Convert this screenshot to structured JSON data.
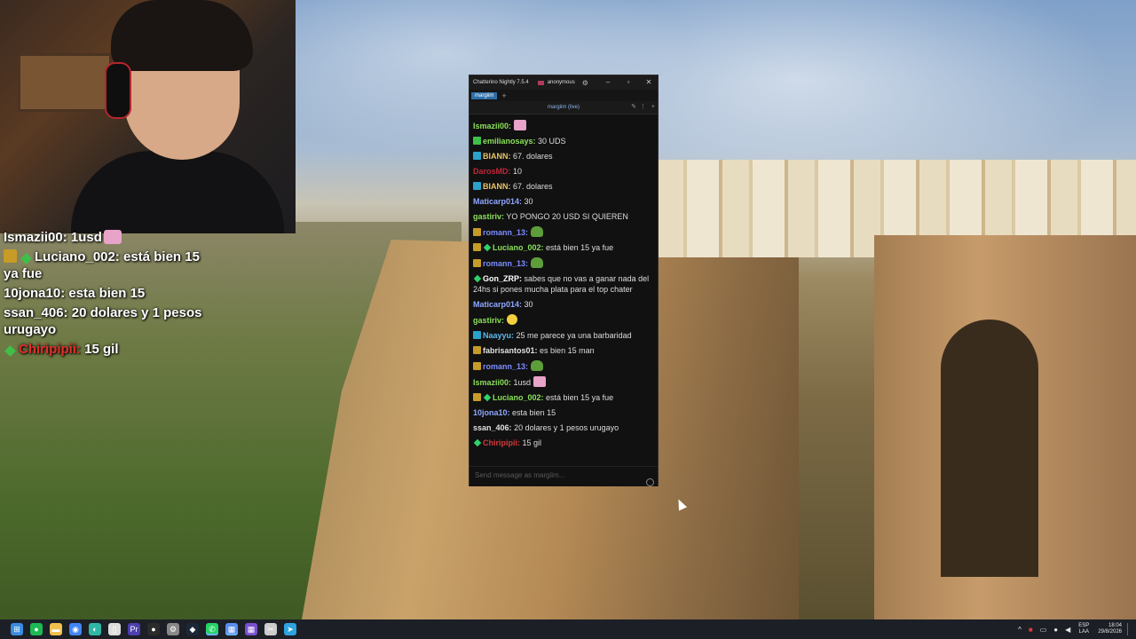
{
  "overlay": {
    "lines": [
      {
        "user": "Ismazii00:",
        "text": "1usd",
        "color": "#ffffff",
        "badges": [],
        "emote": "pink"
      },
      {
        "user": "Luciano_002:",
        "text": "está bien 15 ya fue",
        "color": "#ffffff",
        "badges": [
          "sub",
          "green"
        ]
      },
      {
        "user": "10jona10:",
        "text": "esta bien 15",
        "color": "#ffffff",
        "badges": []
      },
      {
        "user": "ssan_406:",
        "text": "20 dolares y 1 pesos urugayo",
        "color": "#ffffff",
        "badges": []
      },
      {
        "user": "Chiripipii:",
        "text": "15 gil",
        "color": "#e0302a",
        "badges": [
          "green"
        ]
      }
    ]
  },
  "window": {
    "title": "Chatterino Nightly 7.5.4",
    "user": "anonymous",
    "tab_label": "margiim",
    "tab_add": "+",
    "channel_label": "margiim (live)",
    "input_placeholder": "Send message as margiim..."
  },
  "messages": [
    {
      "user": "Ismazii00:",
      "color": "#8be05a",
      "text": "",
      "badges": [],
      "emote": "pink"
    },
    {
      "user": "emilianosays:",
      "color": "#8be05a",
      "text": "30 UDS",
      "badges": [
        "green"
      ]
    },
    {
      "user": "BIANN:",
      "color": "#e8c56a",
      "text": "67. dolares",
      "badges": [
        "vip"
      ]
    },
    {
      "user": "DarosMD:",
      "color": "#c0273a",
      "text": "10",
      "badges": []
    },
    {
      "user": "BIANN:",
      "color": "#e8c56a",
      "text": "67. dolares",
      "badges": [
        "vip"
      ]
    },
    {
      "user": "Maticarp014:",
      "color": "#8fa7ff",
      "text": "30",
      "badges": []
    },
    {
      "user": "gastiriv:",
      "color": "#8be05a",
      "text": "YO PONGO 20 USD SI QUIEREN",
      "badges": []
    },
    {
      "user": "romann_13:",
      "color": "#7d8cff",
      "text": "",
      "badges": [
        "sub"
      ],
      "emote": "frog"
    },
    {
      "user": "Luciano_002:",
      "color": "#8be05a",
      "text": "está bien 15 ya fue",
      "badges": [
        "sub"
      ],
      "diamond": true
    },
    {
      "user": "romann_13:",
      "color": "#7d8cff",
      "text": "",
      "badges": [
        "sub"
      ],
      "emote": "frog"
    },
    {
      "user": "Gon_ZRP:",
      "color": "#ffffff",
      "text": "sabes que no vas a ganar nada del 24hs si pones mucha plata para el top chater",
      "badges": [],
      "diamond": true
    },
    {
      "user": "Maticarp014:",
      "color": "#8fa7ff",
      "text": "30",
      "badges": []
    },
    {
      "user": "gastiriv:",
      "color": "#8be05a",
      "text": "",
      "badges": [],
      "emote": "face"
    },
    {
      "user": "Naayyu:",
      "color": "#5fb7e8",
      "text": "25 me parece ya una barbaridad",
      "badges": [
        "vip"
      ]
    },
    {
      "user": "fabrisantos01:",
      "color": "#e0e0e0",
      "text": "es bien 15 man",
      "badges": [
        "sub"
      ]
    },
    {
      "user": "romann_13:",
      "color": "#7d8cff",
      "text": "",
      "badges": [
        "sub"
      ],
      "emote": "frog"
    },
    {
      "user": "Ismazii00:",
      "color": "#8be05a",
      "text": "1usd",
      "badges": [],
      "emote": "pink"
    },
    {
      "user": "Luciano_002:",
      "color": "#8be05a",
      "text": "está bien 15 ya fue",
      "badges": [
        "sub"
      ],
      "diamond": true
    },
    {
      "user": "10jona10:",
      "color": "#8fa7ff",
      "text": "esta bien 15",
      "badges": []
    },
    {
      "user": "ssan_406:",
      "color": "#e0e0e0",
      "text": "20 dolares y 1 pesos urugayo",
      "badges": []
    },
    {
      "user": "Chiripipii:",
      "color": "#d13a3a",
      "text": "15 gil",
      "badges": [],
      "diamond": true
    }
  ],
  "taskbar": {
    "icons": [
      "windows-icon",
      "spotify-icon",
      "explorer-icon",
      "chrome-icon",
      "edge-icon",
      "file-icon",
      "premiere-icon",
      "obs-icon",
      "settings-icon",
      "steam-icon",
      "whatsapp-icon",
      "chatterino-icon",
      "chatterino-nightly-icon",
      "capcut-icon",
      "telegram-icon"
    ],
    "lang_top": "ESP",
    "lang_bottom": "LAA",
    "time": "18:04",
    "date": "29/8/2026"
  }
}
